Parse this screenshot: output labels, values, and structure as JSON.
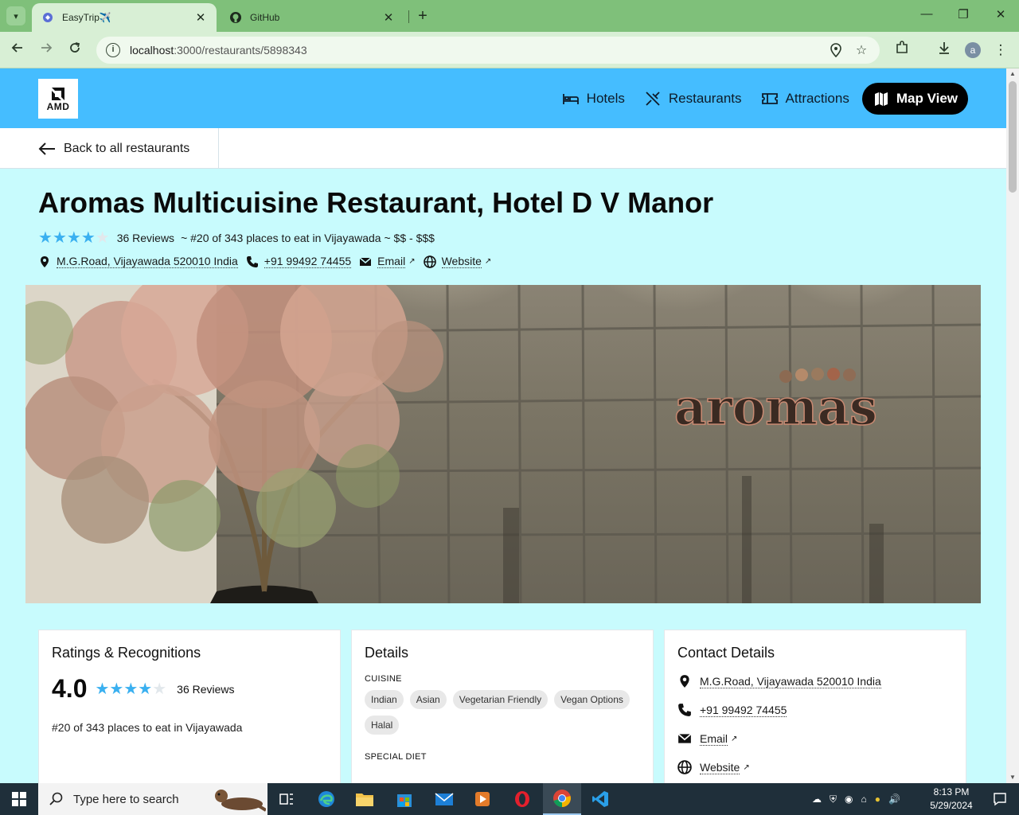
{
  "browser": {
    "tabs": [
      {
        "title": "EasyTrip✈️",
        "close": "✕"
      },
      {
        "title": "GitHub",
        "close": "✕"
      }
    ],
    "new_tab": "+",
    "url_host": "localhost",
    "url_path": ":3000/restaurants/5898343",
    "profile_initial": "a",
    "window": {
      "minimize": "—",
      "maximize": "❐",
      "close": "✕"
    }
  },
  "site": {
    "logo_text": "AMD",
    "nav": [
      {
        "label": "Hotels",
        "icon": "bed-icon"
      },
      {
        "label": "Restaurants",
        "icon": "utensils-icon"
      },
      {
        "label": "Attractions",
        "icon": "ticket-icon"
      },
      {
        "label": "Map View",
        "icon": "map-icon"
      }
    ],
    "back_label": "Back to all restaurants"
  },
  "restaurant": {
    "name": "Aromas Multicuisine Restaurant, Hotel D V Manor",
    "rating": "4.0",
    "rating_value": 4,
    "reviews": "36 Reviews",
    "ranking_line": "~ #20 of 343 places to eat in Vijayawada ~ $$ - $$$",
    "ranking": "#20 of 343 places to eat in Vijayawada",
    "address": "M.G.Road, Vijayawada 520010 India",
    "phone": "+91 99492 74455",
    "email_label": "Email",
    "website_label": "Website",
    "hero_sign": "aromas"
  },
  "cards": {
    "ratings_title": "Ratings & Recognitions",
    "details_title": "Details",
    "contact_title": "Contact Details",
    "cuisine_label": "CUISINE",
    "cuisines": [
      "Indian",
      "Asian",
      "Vegetarian Friendly",
      "Vegan Options",
      "Halal"
    ],
    "special_diet_label": "SPECIAL DIET"
  },
  "taskbar": {
    "search_placeholder": "Type here to search",
    "time": "8:13 PM",
    "date": "5/29/2024"
  },
  "colors": {
    "header_blue": "#45bdff",
    "page_bg": "#c8fbfd",
    "star": "#3ab0f0",
    "tab_green": "#7fc07a"
  }
}
